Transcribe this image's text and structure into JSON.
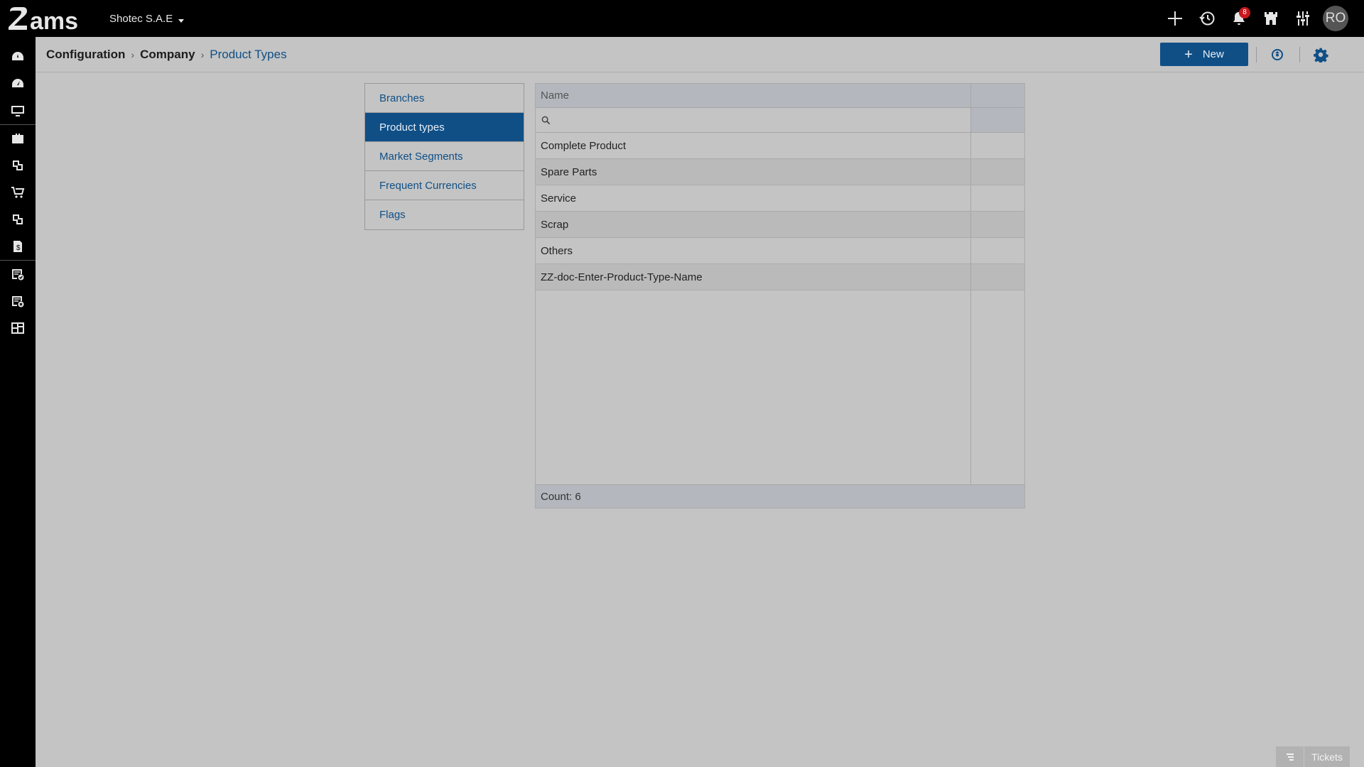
{
  "app": {
    "logo_text": "ams",
    "company": "Shotec S.A.E",
    "notifications_count": "8",
    "avatar_initials": "RO"
  },
  "top_actions": [
    {
      "name": "add-icon"
    },
    {
      "name": "history-icon"
    },
    {
      "name": "bell-icon"
    },
    {
      "name": "castle-icon"
    },
    {
      "name": "sliders-icon"
    }
  ],
  "rail_icons": [
    "dashboard-icon",
    "speedometer-icon",
    "monitor-icon",
    "briefcase-icon",
    "documents-icon",
    "cart-icon",
    "documents-alt-icon",
    "money-icon",
    "checklist-icon",
    "report-icon",
    "grid-layout-icon"
  ],
  "breadcrumb": {
    "items": [
      "Configuration",
      "Company",
      "Product Types"
    ]
  },
  "toolbar": {
    "new_label": "New"
  },
  "sidemenu": {
    "items": [
      "Branches",
      "Product types",
      "Market Segments",
      "Frequent Currencies",
      "Flags"
    ],
    "active_index": 1
  },
  "grid": {
    "header_name": "Name",
    "search_placeholder": "",
    "rows": [
      "Complete Product",
      "Spare Parts",
      "Service",
      "Scrap",
      "Others",
      "ZZ-doc-Enter-Product-Type-Name"
    ],
    "count_text": "Count: 6"
  },
  "footer": {
    "tickets_label": "Tickets"
  },
  "colors": {
    "primary": "#0f4f86",
    "topbar": "#000000",
    "background": "#c4c4c4",
    "badge": "#c8191e"
  }
}
